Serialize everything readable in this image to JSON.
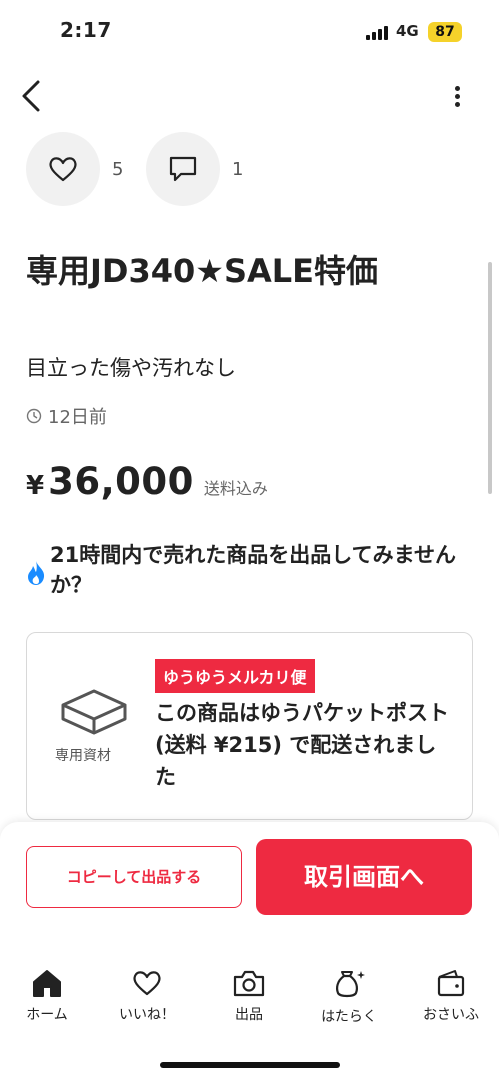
{
  "status": {
    "time": "2:17",
    "network": "4G",
    "battery": "87"
  },
  "social": {
    "like_count": "5",
    "comment_count": "1"
  },
  "item": {
    "title": "専用JD340★SALE特価",
    "condition": "目立った傷や汚れなし",
    "posted": "12日前",
    "currency": "¥",
    "price": "36,000",
    "shipping_note": "送料込み"
  },
  "promo": {
    "text": "21時間内で売れた商品を出品してみませんか？"
  },
  "shipping": {
    "badge": "ゆうゆうメルカリ便",
    "material_label": "専用資材",
    "description": "この商品はゆうパケットポスト (送料 ¥215) で配送されました"
  },
  "actions": {
    "copy_label": "コピーして出品する",
    "trade_label": "取引画面へ"
  },
  "tabs": [
    {
      "label": "ホーム",
      "icon": "home-icon"
    },
    {
      "label": "いいね！",
      "icon": "heart-icon"
    },
    {
      "label": "出品",
      "icon": "camera-icon"
    },
    {
      "label": "はたらく",
      "icon": "money-bag-icon"
    },
    {
      "label": "おさいふ",
      "icon": "wallet-icon"
    }
  ],
  "colors": {
    "accent": "#ee2a41",
    "promo_icon": "#1a8cff",
    "battery": "#f5d22a"
  }
}
